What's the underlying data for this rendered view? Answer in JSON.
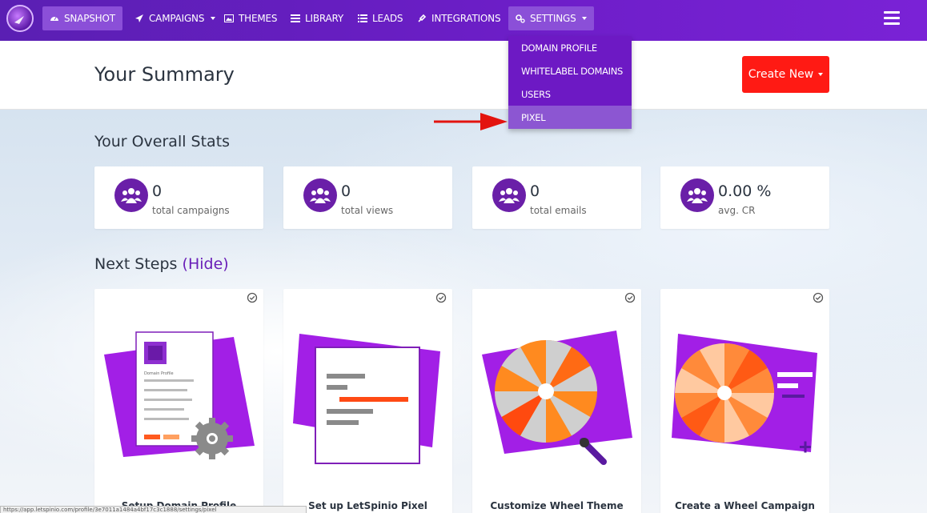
{
  "nav": {
    "items": [
      {
        "label": "SNAPSHOT",
        "icon": "dashboard-icon"
      },
      {
        "label": "CAMPAIGNS",
        "icon": "paper-plane-icon"
      },
      {
        "label": "THEMES",
        "icon": "image-icon"
      },
      {
        "label": "LIBRARY",
        "icon": "library-icon"
      },
      {
        "label": "LEADS",
        "icon": "list-icon"
      },
      {
        "label": "INTEGRATIONS",
        "icon": "plug-icon"
      },
      {
        "label": "SETTINGS",
        "icon": "cogs-icon"
      }
    ],
    "active": "SNAPSHOT"
  },
  "settings_menu": {
    "items": [
      {
        "label": "DOMAIN PROFILE"
      },
      {
        "label": "WHITELABEL DOMAINS"
      },
      {
        "label": "USERS"
      },
      {
        "label": "PIXEL"
      }
    ],
    "highlighted": "PIXEL"
  },
  "summary": {
    "title": "Your Summary",
    "create_label": "Create New"
  },
  "stats": {
    "title": "Your Overall Stats",
    "items": [
      {
        "value": "0",
        "label": "total campaigns"
      },
      {
        "value": "0",
        "label": "total views"
      },
      {
        "value": "0",
        "label": "total emails"
      },
      {
        "value": "0.00 %",
        "label": "avg. CR"
      }
    ]
  },
  "next_steps": {
    "title": "Next Steps",
    "hide_label": "Hide",
    "cards": [
      {
        "title": "Setup Domain Profile",
        "illus_text": "Domain Profile"
      },
      {
        "title": "Set up LetSpinio Pixel"
      },
      {
        "title": "Customize Wheel Theme"
      },
      {
        "title": "Create a Wheel Campaign"
      }
    ]
  },
  "status_bar": {
    "text": "https://app.letspinio.com/profile/3e7011a1484a4bf17c3c1888/settings/pixel"
  },
  "colors": {
    "nav_bg": "#6a1ec4",
    "accent_purple": "#6a1fa8",
    "create_button": "#ff1a14",
    "highlight": "#8c56d2"
  }
}
